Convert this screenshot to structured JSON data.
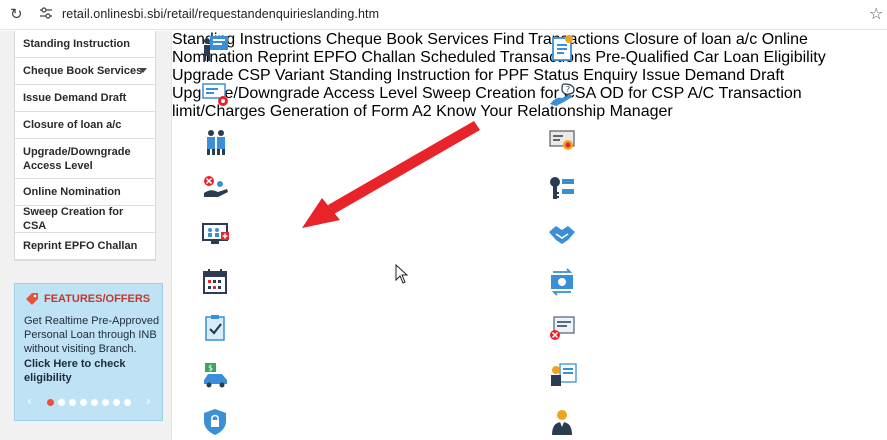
{
  "browser": {
    "url": "retail.onlinesbi.sbi/retail/requestandenquirieslanding.htm"
  },
  "sidebar": {
    "items": [
      {
        "label": "Standing Instruction"
      },
      {
        "label": "Cheque Book Services"
      },
      {
        "label": "Issue Demand Draft"
      },
      {
        "label": "Closure of loan a/c"
      },
      {
        "label": "Upgrade/Downgrade Access Level"
      },
      {
        "label": "Online Nomination"
      },
      {
        "label": "Sweep Creation for CSA"
      },
      {
        "label": "Reprint EPFO Challan"
      }
    ]
  },
  "features": {
    "title": "FEATURES/OFFERS",
    "text": "Get Realtime Pre-Approved Personal Loan through INB without visiting Branch.",
    "link": "Click Here to check eligibility",
    "slide_count": 9,
    "active_slide": 1
  },
  "services": {
    "left": [
      {
        "label": "Standing Instructions",
        "icon": "standing-instructions-icon"
      },
      {
        "label": "Cheque Book Services",
        "icon": "cheque-book-icon"
      },
      {
        "label": "Find Transactions",
        "icon": "find-transactions-icon"
      },
      {
        "label": "Closure of loan a/c",
        "icon": "loan-closure-icon"
      },
      {
        "label": "Online Nomination",
        "icon": "online-nomination-icon"
      },
      {
        "label": "Reprint EPFO Challan",
        "icon": "calendar-icon"
      },
      {
        "label": "Scheduled Transactions",
        "icon": "scheduled-transactions-icon"
      },
      {
        "label": "Pre-Qualified Car Loan Eligibility",
        "icon": "car-loan-icon"
      },
      {
        "label": "Upgrade CSP Variant",
        "icon": "shield-lock-icon"
      }
    ],
    "right": [
      {
        "label": "Standing Instruction for PPF",
        "icon": "ppf-document-icon"
      },
      {
        "label": "Status Enquiry",
        "icon": "status-enquiry-icon"
      },
      {
        "label": "Issue Demand Draft",
        "icon": "demand-draft-icon"
      },
      {
        "label": "Upgrade/Downgrade Access Level",
        "icon": "access-level-icon"
      },
      {
        "label": "Sweep Creation for CSA",
        "icon": "handshake-icon"
      },
      {
        "label": "OD for CSP A/C",
        "icon": "od-transfer-icon"
      },
      {
        "label": "Transaction limit/Charges",
        "icon": "transaction-limit-icon"
      },
      {
        "label": "Generation of Form A2",
        "icon": "form-a2-icon"
      },
      {
        "label": "Know Your Relationship Manager",
        "icon": "relationship-manager-icon"
      }
    ]
  },
  "colors": {
    "link": "#2a7fb8",
    "arrow": "#e8232a",
    "features_bg": "#bfe3f4",
    "features_title": "#c0392b"
  }
}
